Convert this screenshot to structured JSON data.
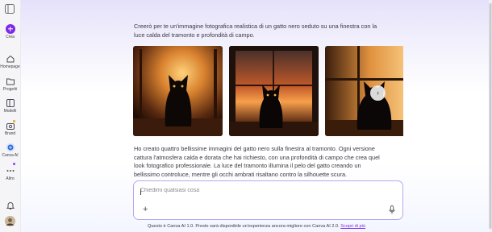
{
  "sidebar": {
    "create_label": "Crea",
    "items": [
      {
        "label": "Homepage",
        "icon": "home-icon"
      },
      {
        "label": "Progetti",
        "icon": "folder-icon"
      },
      {
        "label": "Modelli",
        "icon": "templates-icon"
      },
      {
        "label": "Brand",
        "icon": "brand-icon"
      },
      {
        "label": "Canva AI",
        "icon": "canva-ai-icon"
      },
      {
        "label": "Altro",
        "icon": "more-icon"
      }
    ],
    "bell_icon": "bell-icon",
    "avatar_icon": "avatar"
  },
  "conversation": {
    "user_prompt": "Creerò per te un'immagine fotografica realistica di un gatto nero seduto su una finestra con la luce calda del tramonto e profondità di campo.",
    "images": [
      {
        "name": "black-cat-image-1"
      },
      {
        "name": "black-cat-image-2"
      },
      {
        "name": "black-cat-image-3"
      }
    ],
    "assistant_response": "Ho creato quattro bellissime immagini del gatto nero sulla finestra al tramonto. Ogni versione cattura l'atmosfera calda e dorata che hai richiesto, con una profondità di campo che crea quel look fotografico professionale. La luce del tramonto illumina il pelo del gatto creando un bellissimo controluce, mentre gli occhi ambrati risaltano contro la silhouette scura."
  },
  "chat": {
    "placeholder": "Chiedimi qualsiasi cosa",
    "add_icon": "plus-icon",
    "mic_icon": "microphone-icon"
  },
  "footer": {
    "text": "Questo è Canva AI 1.0. Presto sarà disponibile un'esperienza ancora migliore con Canva AI 2.0.",
    "link": "Scopri di più"
  },
  "colors": {
    "accent": "#7d2ae8",
    "badge_orange": "#f2a01e",
    "badge_purple": "#8b3dff"
  }
}
